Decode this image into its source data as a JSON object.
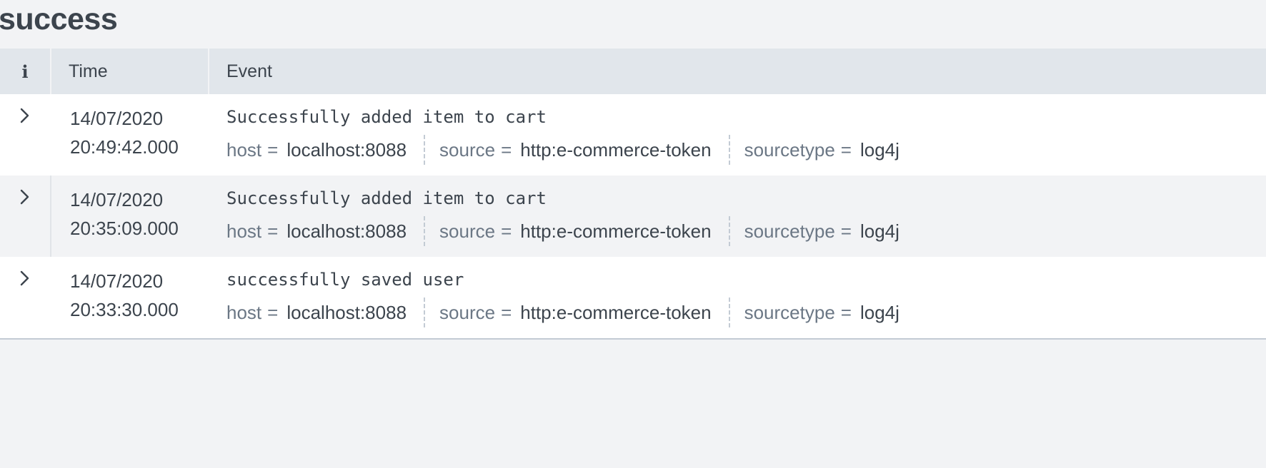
{
  "page": {
    "title": "success"
  },
  "table": {
    "headers": {
      "info": "i",
      "time": "Time",
      "event": "Event"
    },
    "rows": [
      {
        "date": "14/07/2020",
        "time": "20:49:42.000",
        "message": "Successfully added item to cart",
        "fields": [
          {
            "key": "host",
            "eq": "=",
            "value": "localhost:8088"
          },
          {
            "key": "source",
            "eq": "=",
            "value": "http:e-commerce-token"
          },
          {
            "key": "sourcetype",
            "eq": "=",
            "value": "log4j"
          }
        ]
      },
      {
        "date": "14/07/2020",
        "time": "20:35:09.000",
        "message": "Successfully added item to cart",
        "fields": [
          {
            "key": "host",
            "eq": "=",
            "value": "localhost:8088"
          },
          {
            "key": "source",
            "eq": "=",
            "value": "http:e-commerce-token"
          },
          {
            "key": "sourcetype",
            "eq": "=",
            "value": "log4j"
          }
        ]
      },
      {
        "date": "14/07/2020",
        "time": "20:33:30.000",
        "message": "successfully saved user",
        "fields": [
          {
            "key": "host",
            "eq": "=",
            "value": "localhost:8088"
          },
          {
            "key": "source",
            "eq": "=",
            "value": "http:e-commerce-token"
          },
          {
            "key": "sourcetype",
            "eq": "=",
            "value": "log4j"
          }
        ]
      }
    ]
  },
  "icons": {
    "info": "info-icon",
    "expand": "chevron-right-icon"
  },
  "colors": {
    "background": "#f2f3f5",
    "header": "#e1e6eb",
    "text": "#3c444d",
    "muted": "#6b7785"
  }
}
